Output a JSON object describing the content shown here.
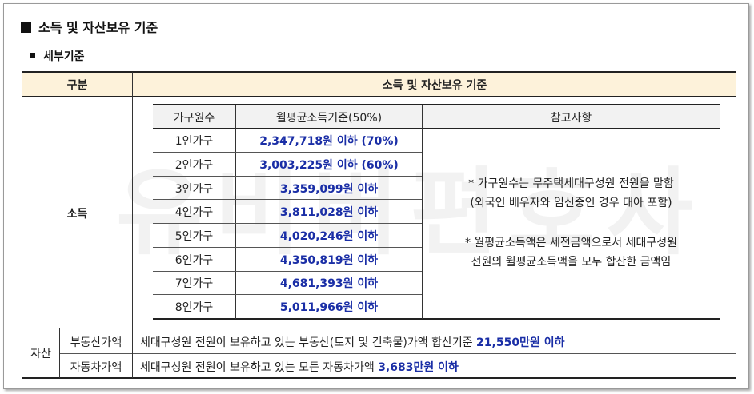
{
  "section_title": "소득 및 자산보유 기준",
  "subsection_title": "세부기준",
  "watermark": "유비버편호사",
  "table": {
    "header_col1": "구분",
    "header_col2": "소득 및 자산보유 기준",
    "income_label": "소득",
    "income_table": {
      "headers": [
        "가구원수",
        "월평균소득기준(50%)",
        "참고사항"
      ],
      "rows": [
        {
          "household": "1인가구",
          "amount": "2,347,718원 이하 (70%)"
        },
        {
          "household": "2인가구",
          "amount": "3,003,225원 이하 (60%)"
        },
        {
          "household": "3인가구",
          "amount": "3,359,099원 이하"
        },
        {
          "household": "4인가구",
          "amount": "3,811,028원 이하"
        },
        {
          "household": "5인가구",
          "amount": "4,020,246원 이하"
        },
        {
          "household": "6인가구",
          "amount": "4,350,819원 이하"
        },
        {
          "household": "7인가구",
          "amount": "4,681,393원 이하"
        },
        {
          "household": "8인가구",
          "amount": "5,011,966원 이하"
        }
      ],
      "notes": [
        {
          "line1": "* 가구원수는 무주택세대구성원 전원을 말함",
          "line2": "(외국인 배우자와 임신중인 경우 태아 포함)"
        },
        {
          "line1": "* 월평균소득액은 세전금액으로서 세대구성원",
          "line2": "전원의 월평균소득액을 모두 합산한 금액임"
        }
      ]
    },
    "asset_label": "자산",
    "asset_rows": [
      {
        "label": "부동산가액",
        "desc": "세대구성원 전원이 보유하고 있는 부동산(토지 및 건축물)가액 합산기준 ",
        "limit": "21,550만원 이하"
      },
      {
        "label": "자동차가액",
        "desc": "세대구성원 전원이 보유하고 있는 모든 자동차가액 ",
        "limit": "3,683만원 이하"
      }
    ]
  },
  "colors": {
    "header_bg": "#fdf2da",
    "inner_header_bg": "#f2f2f2",
    "accent_blue": "#1a2ea6"
  }
}
